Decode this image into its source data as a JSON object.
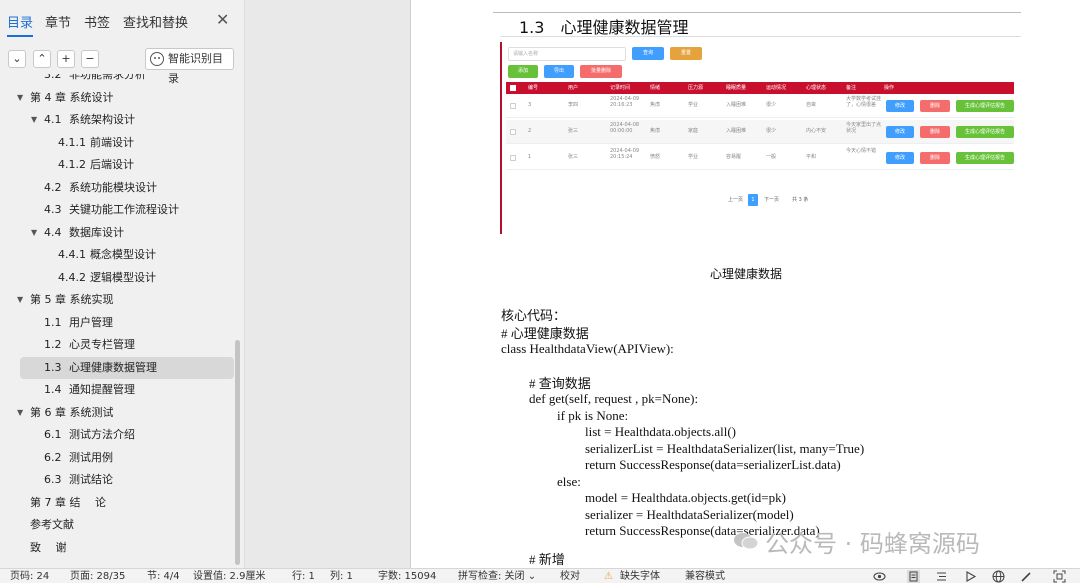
{
  "nav_tabs": [
    "目录",
    "章节",
    "书签",
    "查找和替换"
  ],
  "nav_toolbar": {
    "smart_toc": "智能识别目录"
  },
  "toc": [
    {
      "num": "3.2",
      "text": "非功能需求分析",
      "caret": ""
    },
    {
      "num": "",
      "text": "第 4 章  系统设计",
      "caret": "▼"
    },
    {
      "num": "4.1",
      "text": "系统架构设计",
      "caret": "▼"
    },
    {
      "num": "4.1.1",
      "text": "前端设计",
      "caret": ""
    },
    {
      "num": "4.1.2",
      "text": "后端设计",
      "caret": ""
    },
    {
      "num": "4.2",
      "text": "系统功能模块设计",
      "caret": ""
    },
    {
      "num": "4.3",
      "text": "关键功能工作流程设计",
      "caret": ""
    },
    {
      "num": "4.4",
      "text": "数据库设计",
      "caret": "▼"
    },
    {
      "num": "4.4.1",
      "text": "概念模型设计",
      "caret": ""
    },
    {
      "num": "4.4.2",
      "text": "逻辑模型设计",
      "caret": ""
    },
    {
      "num": "",
      "text": "第 5 章  系统实现",
      "caret": "▼"
    },
    {
      "num": "1.1",
      "text": "用户管理",
      "caret": ""
    },
    {
      "num": "1.2",
      "text": "心灵专栏管理",
      "caret": ""
    },
    {
      "num": "1.3",
      "text": "心理健康数据管理",
      "caret": "",
      "selected": true
    },
    {
      "num": "1.4",
      "text": "通知提醒管理",
      "caret": ""
    },
    {
      "num": "",
      "text": "第 6 章  系统测试",
      "caret": "▼"
    },
    {
      "num": "6.1",
      "text": "测试方法介绍",
      "caret": ""
    },
    {
      "num": "6.2",
      "text": "测试用例",
      "caret": ""
    },
    {
      "num": "6.3",
      "text": "测试结论",
      "caret": ""
    },
    {
      "num": "",
      "text": "第 7 章  结　 论",
      "caret": ""
    },
    {
      "num": "",
      "text": "参考文献",
      "caret": ""
    },
    {
      "num": "",
      "text": "致　 谢",
      "caret": ""
    }
  ],
  "doc": {
    "heading_marker": "H",
    "heading_marker_sub": "2",
    "section_title": "1.3　心理健康数据管理",
    "figure_caption": "心理健康数据",
    "code_lines": [
      "核心代码：",
      "#  心理健康数据",
      "class HealthdataView(APIView):",
      "#  查询数据",
      "def get(self, request , pk=None):",
      "if pk is None:",
      "list = Healthdata.objects.all()",
      "serializerList = HealthdataSerializer(list, many=True)",
      "return SuccessResponse(data=serializerList.data)",
      "else:",
      "model = Healthdata.objects.get(id=pk)",
      "serializer = HealthdataSerializer(model)",
      "return SuccessResponse(data=serializer.data)",
      "#  新增"
    ]
  },
  "embedded": {
    "search_placeholder": "请输入名称",
    "btn_query": "查询",
    "btn_reset": "重置",
    "btn_add": "添加",
    "btn_export": "导出",
    "btn_batch_delete": "批量删除",
    "headers": [
      "编号",
      "用户",
      "记录时间",
      "情绪",
      "压力源",
      "睡眠质量",
      "运动情况",
      "心理状态",
      "备注",
      "操作"
    ],
    "rows": [
      [
        "3",
        "李四",
        "2024-04-09 20:16:23",
        "焦虑",
        "学业",
        "入睡困难",
        "很少",
        "自卑",
        "大学数学考试挂了，心情很差"
      ],
      [
        "2",
        "张三",
        "2024-04-08 00:00:00",
        "焦虑",
        "家庭",
        "入睡困难",
        "很少",
        "内心不安",
        "今天家里出了点状况"
      ],
      [
        "1",
        "张三",
        "2024-04-09 20:15:24",
        "愤怒",
        "学业",
        "容易醒",
        "一般",
        "平和",
        "今天心情不错"
      ]
    ],
    "row_btn_edit": "修改",
    "row_btn_delete": "删除",
    "row_btn_report": "生成心理评估报告",
    "pager_prev": "上一页",
    "pager_current": "1",
    "pager_next": "下一页",
    "pager_total": "共 3 条"
  },
  "watermark": "公众号 · 码蜂窝源码",
  "status_bar": {
    "page_no": "页码: 24",
    "page": "页面: 28/35",
    "section": "节: 4/4",
    "setting": "设置值: 2.9厘米",
    "row": "行: 1",
    "col": "列: 1",
    "words": "字数: 15094",
    "spell": "拼写检查: 关闭",
    "proof": "校对",
    "missing_font": "缺失字体",
    "compat": "兼容模式"
  },
  "colors": {
    "accent": "#1d6fd6",
    "table_header": "#c8102e",
    "btn_blue": "#409eff",
    "btn_orange": "#e6a23c",
    "btn_green": "#67c23a",
    "btn_red": "#f56c6c"
  }
}
